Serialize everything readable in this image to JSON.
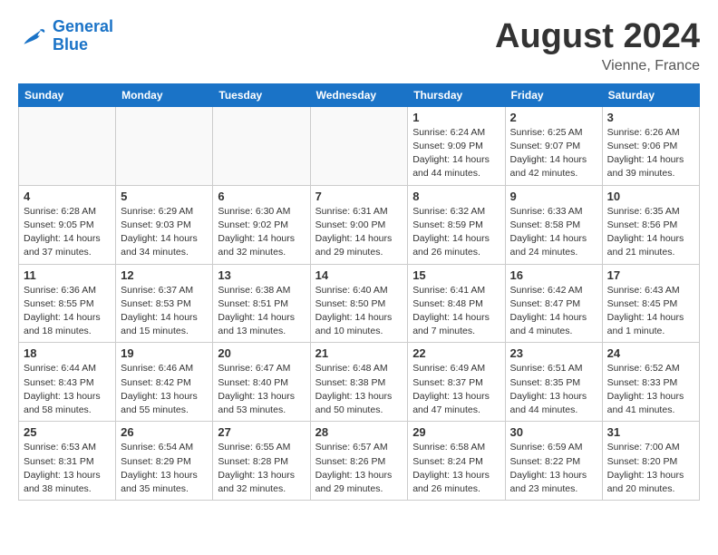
{
  "header": {
    "logo_line1": "General",
    "logo_line2": "Blue",
    "main_title": "August 2024",
    "subtitle": "Vienne, France"
  },
  "days_of_week": [
    "Sunday",
    "Monday",
    "Tuesday",
    "Wednesday",
    "Thursday",
    "Friday",
    "Saturday"
  ],
  "weeks": [
    [
      {
        "day": "",
        "info": ""
      },
      {
        "day": "",
        "info": ""
      },
      {
        "day": "",
        "info": ""
      },
      {
        "day": "",
        "info": ""
      },
      {
        "day": "1",
        "info": "Sunrise: 6:24 AM\nSunset: 9:09 PM\nDaylight: 14 hours\nand 44 minutes."
      },
      {
        "day": "2",
        "info": "Sunrise: 6:25 AM\nSunset: 9:07 PM\nDaylight: 14 hours\nand 42 minutes."
      },
      {
        "day": "3",
        "info": "Sunrise: 6:26 AM\nSunset: 9:06 PM\nDaylight: 14 hours\nand 39 minutes."
      }
    ],
    [
      {
        "day": "4",
        "info": "Sunrise: 6:28 AM\nSunset: 9:05 PM\nDaylight: 14 hours\nand 37 minutes."
      },
      {
        "day": "5",
        "info": "Sunrise: 6:29 AM\nSunset: 9:03 PM\nDaylight: 14 hours\nand 34 minutes."
      },
      {
        "day": "6",
        "info": "Sunrise: 6:30 AM\nSunset: 9:02 PM\nDaylight: 14 hours\nand 32 minutes."
      },
      {
        "day": "7",
        "info": "Sunrise: 6:31 AM\nSunset: 9:00 PM\nDaylight: 14 hours\nand 29 minutes."
      },
      {
        "day": "8",
        "info": "Sunrise: 6:32 AM\nSunset: 8:59 PM\nDaylight: 14 hours\nand 26 minutes."
      },
      {
        "day": "9",
        "info": "Sunrise: 6:33 AM\nSunset: 8:58 PM\nDaylight: 14 hours\nand 24 minutes."
      },
      {
        "day": "10",
        "info": "Sunrise: 6:35 AM\nSunset: 8:56 PM\nDaylight: 14 hours\nand 21 minutes."
      }
    ],
    [
      {
        "day": "11",
        "info": "Sunrise: 6:36 AM\nSunset: 8:55 PM\nDaylight: 14 hours\nand 18 minutes."
      },
      {
        "day": "12",
        "info": "Sunrise: 6:37 AM\nSunset: 8:53 PM\nDaylight: 14 hours\nand 15 minutes."
      },
      {
        "day": "13",
        "info": "Sunrise: 6:38 AM\nSunset: 8:51 PM\nDaylight: 14 hours\nand 13 minutes."
      },
      {
        "day": "14",
        "info": "Sunrise: 6:40 AM\nSunset: 8:50 PM\nDaylight: 14 hours\nand 10 minutes."
      },
      {
        "day": "15",
        "info": "Sunrise: 6:41 AM\nSunset: 8:48 PM\nDaylight: 14 hours\nand 7 minutes."
      },
      {
        "day": "16",
        "info": "Sunrise: 6:42 AM\nSunset: 8:47 PM\nDaylight: 14 hours\nand 4 minutes."
      },
      {
        "day": "17",
        "info": "Sunrise: 6:43 AM\nSunset: 8:45 PM\nDaylight: 14 hours\nand 1 minute."
      }
    ],
    [
      {
        "day": "18",
        "info": "Sunrise: 6:44 AM\nSunset: 8:43 PM\nDaylight: 13 hours\nand 58 minutes."
      },
      {
        "day": "19",
        "info": "Sunrise: 6:46 AM\nSunset: 8:42 PM\nDaylight: 13 hours\nand 55 minutes."
      },
      {
        "day": "20",
        "info": "Sunrise: 6:47 AM\nSunset: 8:40 PM\nDaylight: 13 hours\nand 53 minutes."
      },
      {
        "day": "21",
        "info": "Sunrise: 6:48 AM\nSunset: 8:38 PM\nDaylight: 13 hours\nand 50 minutes."
      },
      {
        "day": "22",
        "info": "Sunrise: 6:49 AM\nSunset: 8:37 PM\nDaylight: 13 hours\nand 47 minutes."
      },
      {
        "day": "23",
        "info": "Sunrise: 6:51 AM\nSunset: 8:35 PM\nDaylight: 13 hours\nand 44 minutes."
      },
      {
        "day": "24",
        "info": "Sunrise: 6:52 AM\nSunset: 8:33 PM\nDaylight: 13 hours\nand 41 minutes."
      }
    ],
    [
      {
        "day": "25",
        "info": "Sunrise: 6:53 AM\nSunset: 8:31 PM\nDaylight: 13 hours\nand 38 minutes."
      },
      {
        "day": "26",
        "info": "Sunrise: 6:54 AM\nSunset: 8:29 PM\nDaylight: 13 hours\nand 35 minutes."
      },
      {
        "day": "27",
        "info": "Sunrise: 6:55 AM\nSunset: 8:28 PM\nDaylight: 13 hours\nand 32 minutes."
      },
      {
        "day": "28",
        "info": "Sunrise: 6:57 AM\nSunset: 8:26 PM\nDaylight: 13 hours\nand 29 minutes."
      },
      {
        "day": "29",
        "info": "Sunrise: 6:58 AM\nSunset: 8:24 PM\nDaylight: 13 hours\nand 26 minutes."
      },
      {
        "day": "30",
        "info": "Sunrise: 6:59 AM\nSunset: 8:22 PM\nDaylight: 13 hours\nand 23 minutes."
      },
      {
        "day": "31",
        "info": "Sunrise: 7:00 AM\nSunset: 8:20 PM\nDaylight: 13 hours\nand 20 minutes."
      }
    ]
  ]
}
